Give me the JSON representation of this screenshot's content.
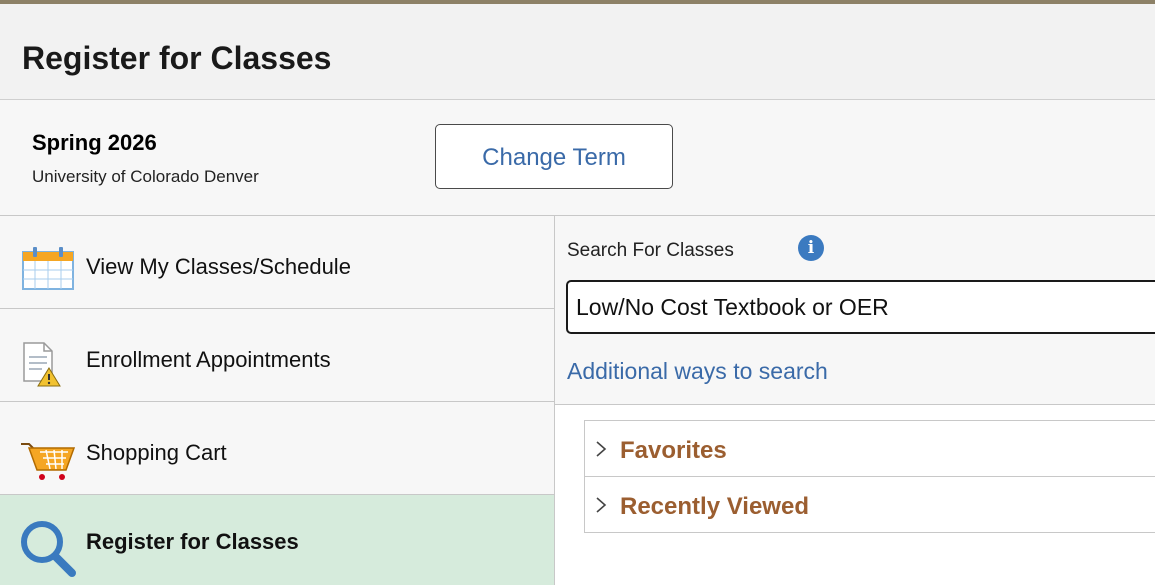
{
  "header": {
    "title": "Register for Classes"
  },
  "term": {
    "name": "Spring 2026",
    "institution": "University of Colorado Denver",
    "change_label": "Change Term"
  },
  "sidebar": {
    "items": [
      {
        "label": "View My Classes/Schedule",
        "icon": "calendar-icon"
      },
      {
        "label": "Enrollment Appointments",
        "icon": "document-warning-icon"
      },
      {
        "label": "Shopping Cart",
        "icon": "shopping-cart-icon"
      },
      {
        "label": "Register for Classes",
        "icon": "magnifier-icon",
        "active": true
      }
    ]
  },
  "search": {
    "label": "Search For Classes",
    "value": "Low/No Cost Textbook or OER",
    "additional_link": "Additional ways to search"
  },
  "accordion": {
    "items": [
      {
        "label": "Favorites"
      },
      {
        "label": "Recently Viewed"
      }
    ]
  },
  "colors": {
    "link": "#3a6aa8",
    "accordion_label": "#9b5e30",
    "active_nav_bg": "#d6ebdc",
    "info_icon": "#3b7ac0"
  }
}
